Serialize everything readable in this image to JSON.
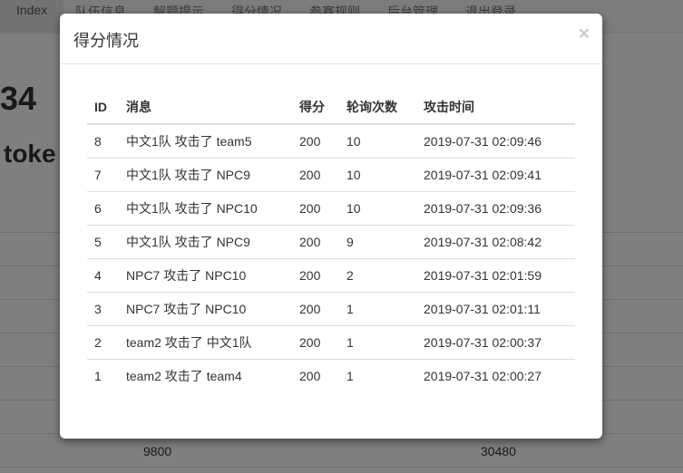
{
  "nav": {
    "items": [
      "Index",
      "队伍信息",
      "解题提示",
      "得分情况",
      "参赛规则",
      "后台管理",
      "退出登录"
    ]
  },
  "background": {
    "heading_fragment": "34",
    "subheading_fragment": "toke",
    "footer_values": [
      "9800",
      "30480"
    ]
  },
  "modal": {
    "title": "得分情况",
    "close_label": "×",
    "columns": [
      "ID",
      "消息",
      "得分",
      "轮询次数",
      "攻击时间"
    ],
    "rows": [
      [
        "8",
        "中文1队 攻击了 team5",
        "200",
        "10",
        "2019-07-31 02:09:46"
      ],
      [
        "7",
        "中文1队 攻击了 NPC9",
        "200",
        "10",
        "2019-07-31 02:09:41"
      ],
      [
        "6",
        "中文1队 攻击了 NPC10",
        "200",
        "10",
        "2019-07-31 02:09:36"
      ],
      [
        "5",
        "中文1队 攻击了 NPC9",
        "200",
        "9",
        "2019-07-31 02:08:42"
      ],
      [
        "4",
        "NPC7 攻击了 NPC10",
        "200",
        "2",
        "2019-07-31 02:01:59"
      ],
      [
        "3",
        "NPC7 攻击了 NPC10",
        "200",
        "1",
        "2019-07-31 02:01:11"
      ],
      [
        "2",
        "team2 攻击了 中文1队",
        "200",
        "1",
        "2019-07-31 02:00:37"
      ],
      [
        "1",
        "team2 攻击了 team4",
        "200",
        "1",
        "2019-07-31 02:00:27"
      ]
    ]
  }
}
